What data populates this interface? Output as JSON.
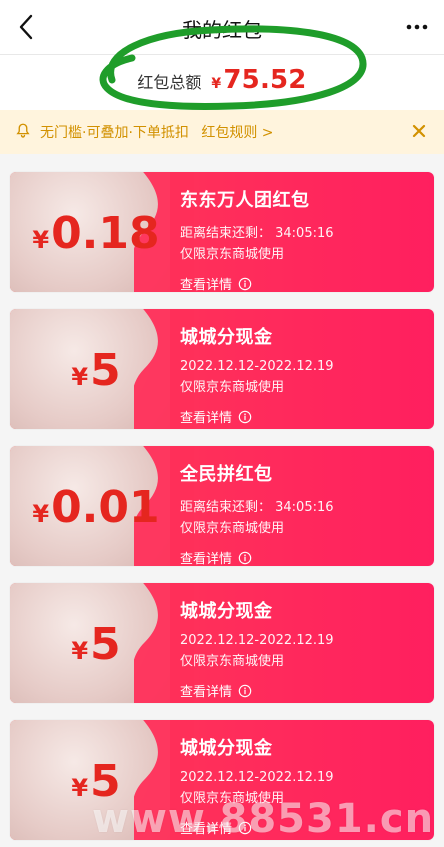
{
  "header": {
    "title": "我的红包"
  },
  "summary": {
    "label": "红包总额",
    "currency": "¥",
    "amount": "75.52"
  },
  "notice": {
    "text": "无门槛·可叠加·下单抵扣",
    "link": "红包规则 >"
  },
  "coupons": [
    {
      "currency": "¥",
      "amount": "0.18",
      "name": "东东万人团红包",
      "line1": "距离结束还剩： 34:05:16",
      "line2": "仅限京东商城使用",
      "detail": "查看详情"
    },
    {
      "currency": "¥",
      "amount": "5",
      "name": "城城分现金",
      "line1": "2022.12.12-2022.12.19",
      "line2": "仅限京东商城使用",
      "detail": "查看详情"
    },
    {
      "currency": "¥",
      "amount": "0.01",
      "name": "全民拼红包",
      "line1": "距离结束还剩： 34:05:16",
      "line2": "仅限京东商城使用",
      "detail": "查看详情"
    },
    {
      "currency": "¥",
      "amount": "5",
      "name": "城城分现金",
      "line1": "2022.12.12-2022.12.19",
      "line2": "仅限京东商城使用",
      "detail": "查看详情"
    },
    {
      "currency": "¥",
      "amount": "5",
      "name": "城城分现金",
      "line1": "2022.12.12-2022.12.19",
      "line2": "仅限京东商城使用",
      "detail": "查看详情"
    }
  ],
  "watermark": {
    "text": "www.88531.cn"
  },
  "icons": {
    "back": "chevron-left-icon",
    "more": "more-horizontal-icon",
    "notice": "bell-icon",
    "close": "close-icon",
    "info": "info-icon"
  },
  "colors": {
    "accent_red": "#e5261f",
    "notice_bg": "#fff4dd",
    "notice_text": "#d29100",
    "coupon_red": "#ff2f5a",
    "marker_green": "#1f9d2a"
  }
}
